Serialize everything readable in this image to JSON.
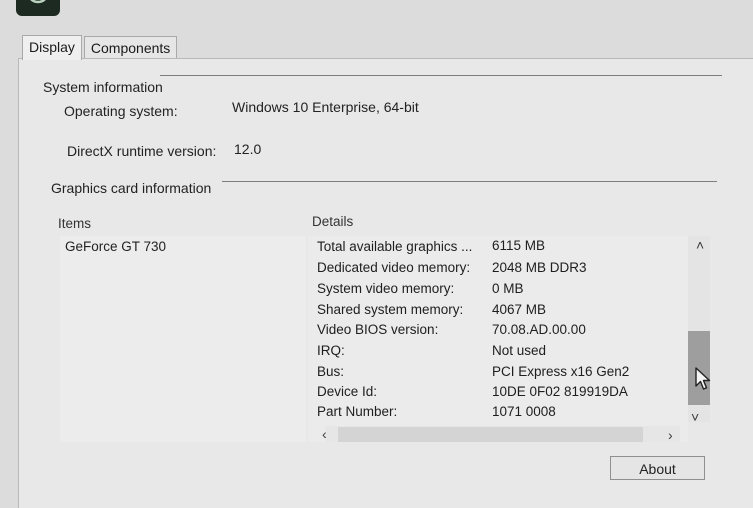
{
  "tabs": [
    {
      "label": "Display",
      "active": true
    },
    {
      "label": "Components",
      "active": false
    }
  ],
  "system_info": {
    "title": "System information",
    "os_label": "Operating system:",
    "os_value": "Windows 10 Enterprise, 64-bit",
    "directx_label": "DirectX runtime version:",
    "directx_value": "12.0"
  },
  "graphics_info": {
    "title": "Graphics card information",
    "items_header": "Items",
    "details_header": "Details",
    "items": [
      "GeForce GT 730"
    ],
    "details": [
      {
        "label": "Total available graphics ...",
        "value": "6115 MB"
      },
      {
        "label": "Dedicated video memory:",
        "value": "2048 MB DDR3"
      },
      {
        "label": "System video memory:",
        "value": "0 MB"
      },
      {
        "label": "Shared system memory:",
        "value": "4067 MB"
      },
      {
        "label": "Video BIOS version:",
        "value": "70.08.AD.00.00"
      },
      {
        "label": "IRQ:",
        "value": "Not used"
      },
      {
        "label": "Bus:",
        "value": "PCI Express x16 Gen2"
      },
      {
        "label": "Device Id:",
        "value": "10DE 0F02 819919DA"
      },
      {
        "label": "Part Number:",
        "value": "1071 0008"
      }
    ]
  },
  "buttons": {
    "about": "About"
  },
  "icons": {
    "app": "nvidia-app-icon",
    "scroll_up": "chevron-up-icon",
    "scroll_down": "chevron-down-icon",
    "scroll_left": "chevron-left-icon",
    "scroll_right": "chevron-right-icon",
    "cursor": "mouse-pointer-icon"
  }
}
